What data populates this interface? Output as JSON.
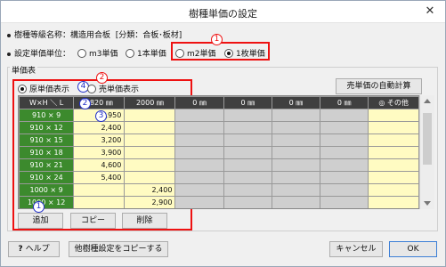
{
  "window": {
    "title": "樹種単価の設定",
    "close_glyph": "✕"
  },
  "info": {
    "label": "樹種等級名称：",
    "name": "構造用合板",
    "category": "[分類：合板･板材]"
  },
  "unit_setting": {
    "label": "設定単価単位：",
    "options": [
      {
        "label": "m3単価",
        "selected": false
      },
      {
        "label": "1本単価",
        "selected": false
      },
      {
        "label": "m2単価",
        "selected": false
      },
      {
        "label": "1枚単価",
        "selected": true
      }
    ]
  },
  "price_table": {
    "label": "単価表",
    "display_options": [
      {
        "label": "原単価表示",
        "selected": true
      },
      {
        "label": "売単価表示",
        "selected": false
      }
    ],
    "auto_calc_button": "売単価の自動計算",
    "columns": [
      "W×H ＼ L",
      "1820 ㎜",
      "2000 ㎜",
      "0 ㎜",
      "0 ㎜",
      "0 ㎜",
      "0 ㎜",
      "◎ その他"
    ],
    "rows": [
      {
        "size": "910 × 9",
        "values": [
          "1,950",
          "",
          "",
          "",
          "",
          "",
          ""
        ]
      },
      {
        "size": "910 × 12",
        "values": [
          "2,400",
          "",
          "",
          "",
          "",
          "",
          ""
        ]
      },
      {
        "size": "910 × 15",
        "values": [
          "3,200",
          "",
          "",
          "",
          "",
          "",
          ""
        ]
      },
      {
        "size": "910 × 18",
        "values": [
          "3,900",
          "",
          "",
          "",
          "",
          "",
          ""
        ]
      },
      {
        "size": "910 × 21",
        "values": [
          "4,600",
          "",
          "",
          "",
          "",
          "",
          ""
        ]
      },
      {
        "size": "910 × 24",
        "values": [
          "5,400",
          "",
          "",
          "",
          "",
          "",
          ""
        ]
      },
      {
        "size": "1000 × 9",
        "values": [
          "",
          "2,400",
          "",
          "",
          "",
          "",
          ""
        ]
      },
      {
        "size": "1000 × 12",
        "values": [
          "",
          "2,900",
          "",
          "",
          "",
          "",
          ""
        ]
      }
    ],
    "buttons": {
      "add": "追加",
      "copy": "コピー",
      "delete": "削除"
    }
  },
  "annotations": {
    "m1": "1",
    "m2": "2",
    "m3": "3",
    "m4": "4"
  },
  "footer": {
    "help": "ヘルプ",
    "copy_other": "他樹種設定をコピーする",
    "cancel": "キャンセル",
    "ok": "OK"
  },
  "colors": {
    "annotation_red": "#ee1111",
    "annotation_blue": "#2230c8",
    "size_green": "#3c8a2d",
    "editable_yellow": "#fffbc2"
  }
}
